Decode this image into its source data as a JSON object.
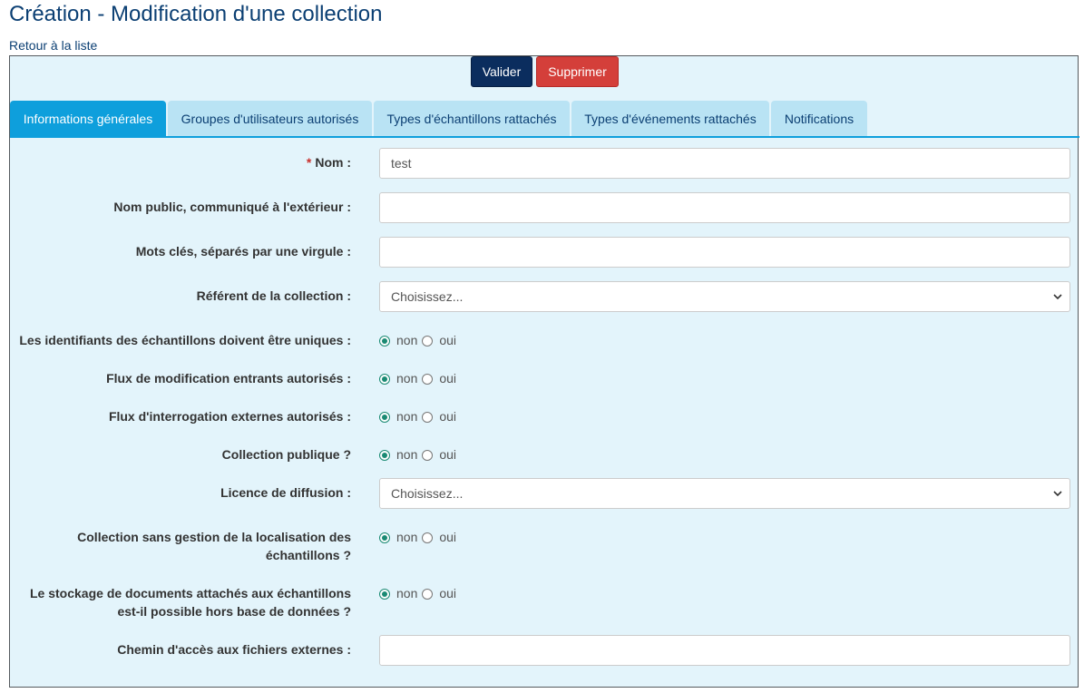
{
  "header": {
    "title": "Création - Modification d'une collection",
    "back_link": "Retour à la liste"
  },
  "toolbar": {
    "validate_label": "Valider",
    "delete_label": "Supprimer"
  },
  "tabs": [
    {
      "label": "Informations générales",
      "active": true
    },
    {
      "label": "Groupes d'utilisateurs autorisés",
      "active": false
    },
    {
      "label": "Types d'échantillons rattachés",
      "active": false
    },
    {
      "label": "Types d'événements rattachés",
      "active": false
    },
    {
      "label": "Notifications",
      "active": false
    }
  ],
  "form": {
    "required_marker": "*",
    "name": {
      "label": "Nom :",
      "value": "test"
    },
    "public_name": {
      "label": "Nom public, communiqué à l'extérieur :",
      "value": ""
    },
    "keywords": {
      "label": "Mots clés, séparés par une virgule :",
      "value": ""
    },
    "referent": {
      "label": "Référent de la collection :",
      "selected": "Choisissez..."
    },
    "unique_ids": {
      "label": "Les identifiants des échantillons doivent être uniques :",
      "value": "non"
    },
    "incoming_flows": {
      "label": "Flux de modification entrants autorisés :",
      "value": "non"
    },
    "external_query": {
      "label": "Flux d'interrogation externes autorisés :",
      "value": "non"
    },
    "public_collection": {
      "label": "Collection publique ?",
      "value": "non"
    },
    "license": {
      "label": "Licence de diffusion :",
      "selected": "Choisissez..."
    },
    "no_location": {
      "label_line1": "Collection sans gestion de la localisation des",
      "label_line2": "échantillons ?",
      "value": "non"
    },
    "external_storage": {
      "label_line1": "Le stockage de documents attachés aux échantillons",
      "label_line2": "est-il possible hors base de données ?",
      "value": "non"
    },
    "external_path": {
      "label": "Chemin d'accès aux fichiers externes :",
      "value": ""
    },
    "radio_options": {
      "no": "non",
      "yes": "oui"
    }
  },
  "colors": {
    "title": "#0b3f73",
    "panel_bg": "#e3f4fb",
    "tab_active": "#0e9fdc",
    "tab_inactive": "#b9e3f4",
    "validate_button": "#0b2d5e",
    "delete_button": "#d43f3a",
    "radio_checked": "#1a8a73"
  },
  "icons": {
    "select_arrow": "chevron-down-icon"
  }
}
